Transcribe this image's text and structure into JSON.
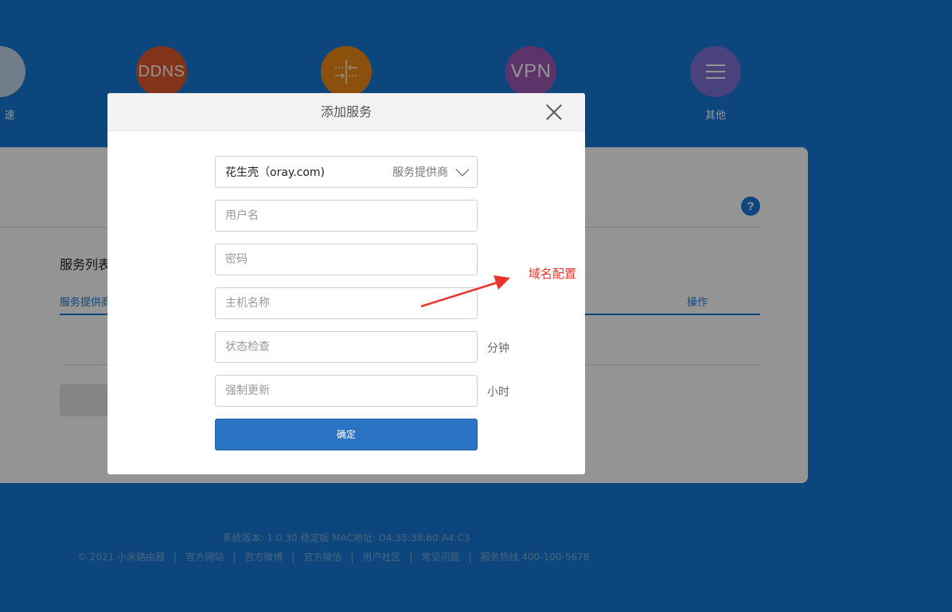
{
  "nav": {
    "items": [
      {
        "label": "速",
        "icon": "speed-icon",
        "color": "#c3d9ee"
      },
      {
        "label": "",
        "text": "DDNS",
        "icon": "ddns-icon",
        "color": "#e05a2f"
      },
      {
        "label": "",
        "icon": "port-forward-icon",
        "color": "#f08c16"
      },
      {
        "label": "",
        "text": "VPN",
        "icon": "vpn-icon",
        "color": "#a05bb5"
      },
      {
        "label": "其他",
        "icon": "menu-icon",
        "color": "#7f73d6"
      }
    ]
  },
  "panel": {
    "list_title": "服务列表",
    "columns": [
      "服务提供商",
      "操作"
    ],
    "help": "?"
  },
  "modal": {
    "title": "添加服务",
    "provider_value": "花生壳（oray.com)",
    "provider_label": "服务提供商",
    "username_placeholder": "用户名",
    "password_placeholder": "密码",
    "hostname_placeholder": "主机名称",
    "status_check_placeholder": "状态检查",
    "status_check_unit": "分钟",
    "force_update_placeholder": "强制更新",
    "force_update_unit": "小时",
    "confirm_label": "确定"
  },
  "annotation": {
    "label": "域名配置",
    "color": "#e8362d"
  },
  "footer": {
    "version": "系统版本: 1.0.30 稳定版   MAC地址: D4:35:38:60:A4:C3",
    "copyright": "© 2021 小米路由器",
    "links": [
      "官方网站",
      "官方微博",
      "官方微信",
      "用户社区",
      "常见问题",
      "服务热线 400-100-5678"
    ]
  }
}
